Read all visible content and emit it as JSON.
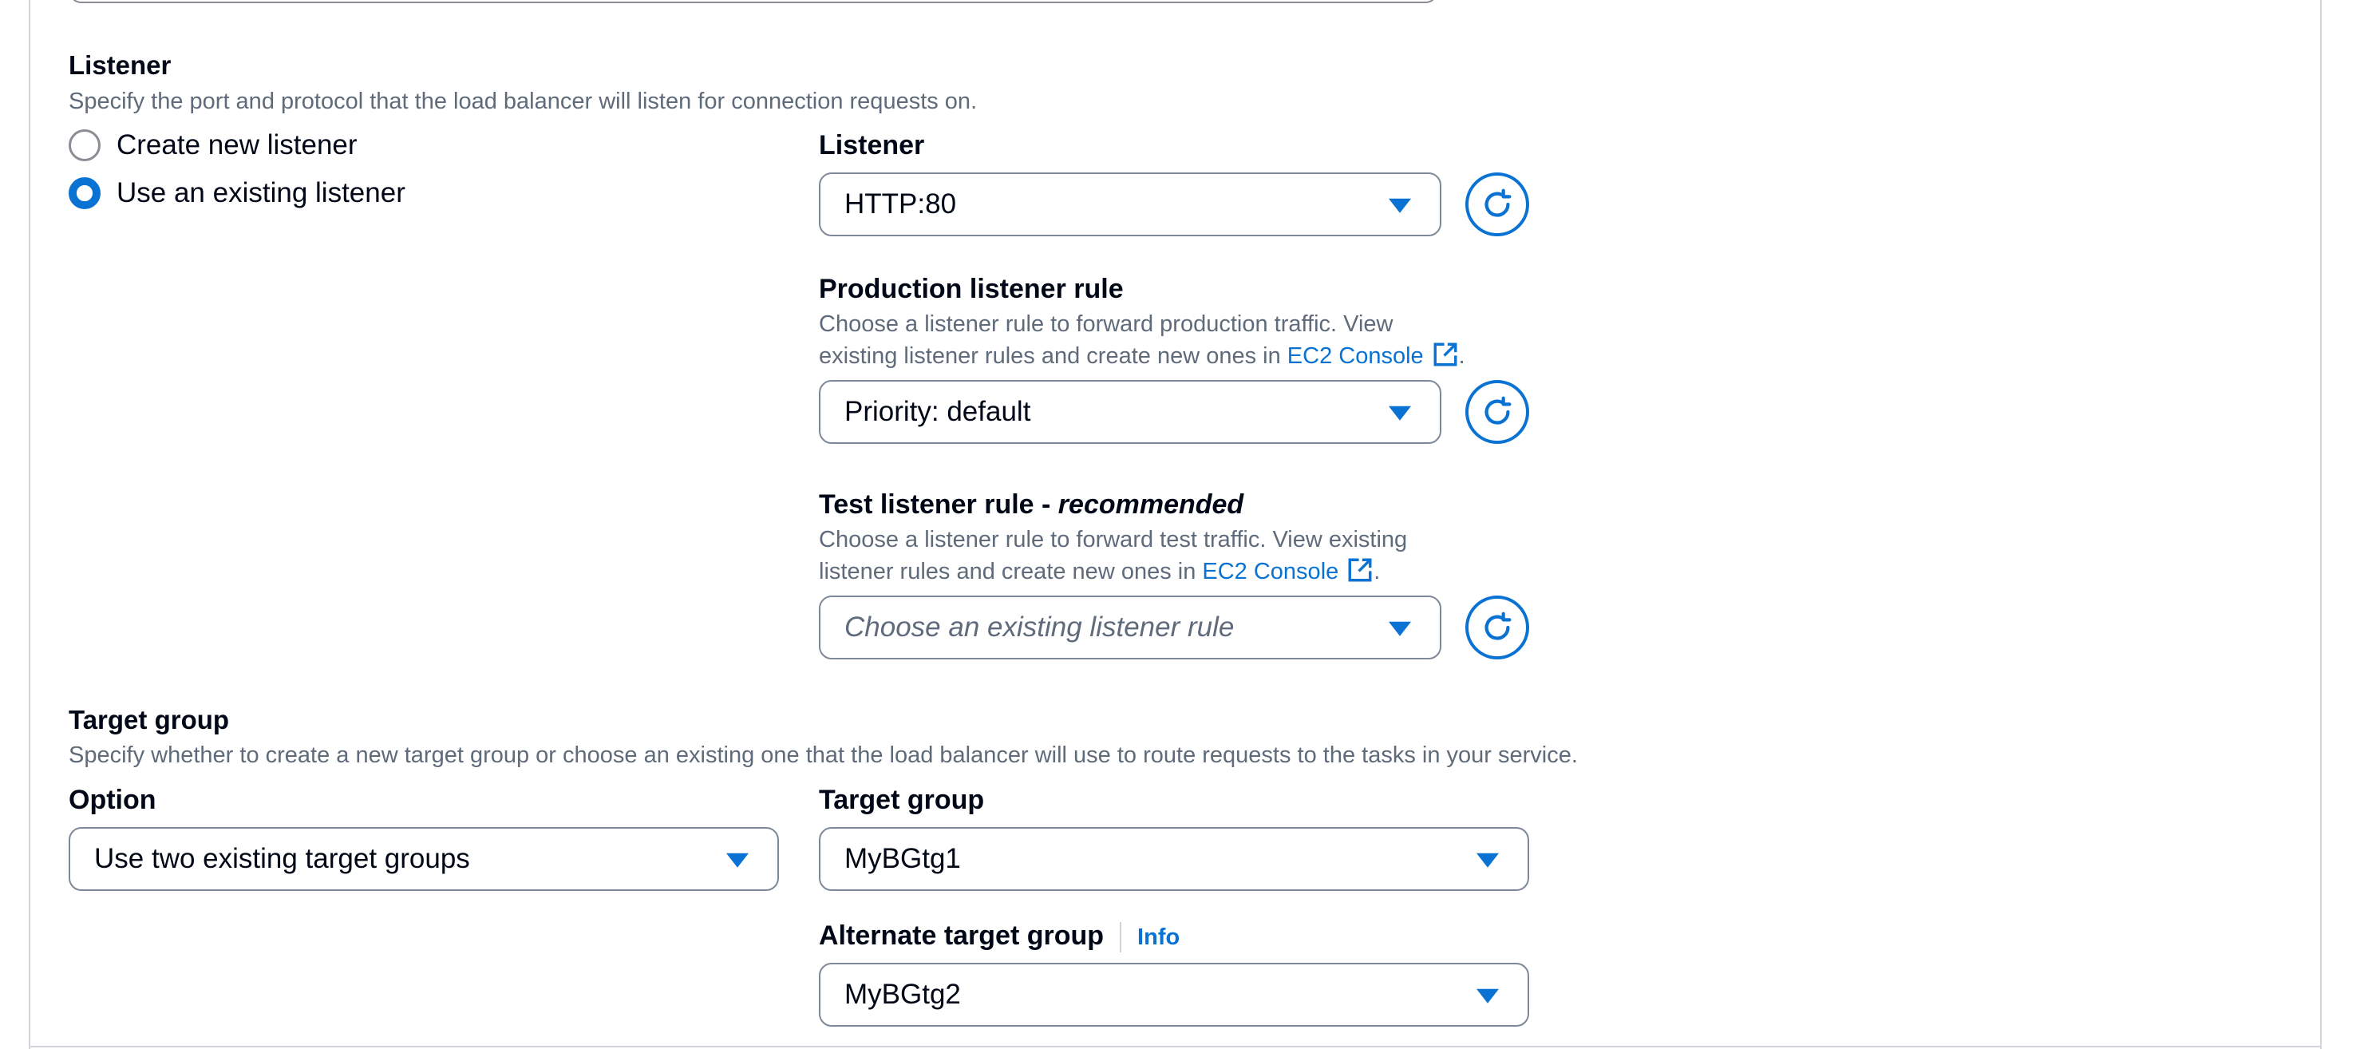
{
  "listener_section": {
    "title": "Listener",
    "description": "Specify the port and protocol that the load balancer will listen for connection requests on.",
    "options": [
      {
        "label": "Create new listener",
        "checked": false
      },
      {
        "label": "Use an existing listener",
        "checked": true
      }
    ],
    "listener": {
      "label": "Listener",
      "value": "HTTP:80"
    },
    "production_rule": {
      "label": "Production listener rule",
      "desc_line1": "Choose a listener rule to forward production traffic. View",
      "desc_line2": "existing listener rules and create new ones in",
      "link": "EC2 Console",
      "value": "Priority: default"
    },
    "test_rule": {
      "label": "Test listener rule - ",
      "label_suffix": "recommended",
      "desc_line1": "Choose a listener rule to forward test traffic. View existing",
      "desc_line2": "listener rules and create new ones in",
      "link": "EC2 Console",
      "placeholder": "Choose an existing listener rule"
    }
  },
  "target_group_section": {
    "title": "Target group",
    "description": "Specify whether to create a new target group or choose an existing one that the load balancer will use to route requests to the tasks in your service.",
    "option": {
      "label": "Option",
      "value": "Use two existing target groups"
    },
    "target_group": {
      "label": "Target group",
      "value": "MyBGtg1"
    },
    "alternate": {
      "label": "Alternate target group",
      "info": "Info",
      "value": "MyBGtg2"
    }
  },
  "icons": {
    "refresh": "refresh-icon",
    "external": "external-link-icon",
    "caret": "caret-down-icon"
  },
  "colors": {
    "accent": "#0972d3",
    "text": "#000716",
    "muted": "#5f6b7a",
    "border": "#7d8998"
  }
}
